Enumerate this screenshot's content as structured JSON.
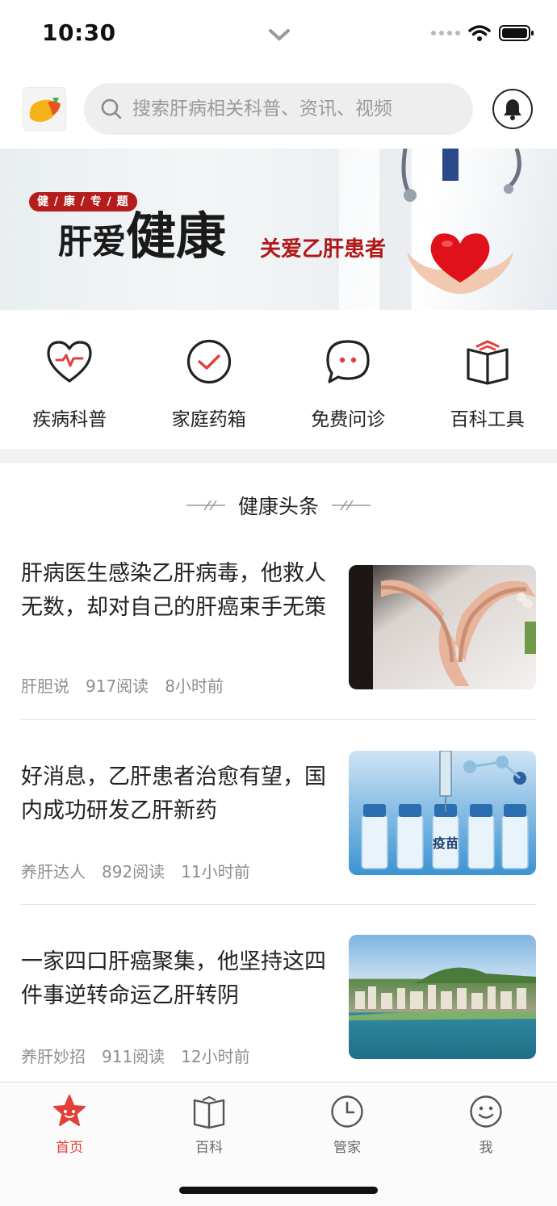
{
  "status_bar": {
    "time": "10:30"
  },
  "header": {
    "search_placeholder": "搜索肝病相关科普、资讯、视频",
    "icons": [
      "app-logo",
      "search-icon",
      "bell-icon"
    ]
  },
  "banner": {
    "tag": "健 / 康 / 专 / 题",
    "title_part1": "肝爱",
    "title_part2": "健康",
    "subtitle": "关爱乙肝患者"
  },
  "quick_nav": [
    {
      "label": "疾病科普",
      "icon": "heart-pulse-icon"
    },
    {
      "label": "家庭药箱",
      "icon": "check-circle-icon"
    },
    {
      "label": "免费问诊",
      "icon": "chat-bubble-icon"
    },
    {
      "label": "百科工具",
      "icon": "book-icon"
    }
  ],
  "section": {
    "title": "健康头条"
  },
  "articles": [
    {
      "title": "肝病医生感染乙肝病毒，他救人无数，却对自己的肝癌束手无策",
      "source": "肝胆说",
      "reads": "917阅读",
      "time": "8小时前",
      "thumb": "heart-hands-photo"
    },
    {
      "title": "好消息，乙肝患者治愈有望，国内成功研发乙肝新药",
      "source": "养肝达人",
      "reads": "892阅读",
      "time": "11小时前",
      "thumb": "vaccine-vials-photo",
      "thumb_label": "疫苗"
    },
    {
      "title": "一家四口肝癌聚集，他坚持这四件事逆转命运乙肝转阴",
      "source": "养肝妙招",
      "reads": "911阅读",
      "time": "12小时前",
      "thumb": "city-river-photo"
    }
  ],
  "tab_bar": {
    "tabs": [
      {
        "label": "首页",
        "icon": "star-face-icon",
        "active": true
      },
      {
        "label": "百科",
        "icon": "open-book-icon",
        "active": false
      },
      {
        "label": "管家",
        "icon": "clock-icon",
        "active": false
      },
      {
        "label": "我",
        "icon": "smiley-icon",
        "active": false
      }
    ]
  },
  "colors": {
    "accent": "#e2403a",
    "banner_red": "#b51c1c",
    "text": "#222222",
    "meta": "#8e8e8e"
  }
}
